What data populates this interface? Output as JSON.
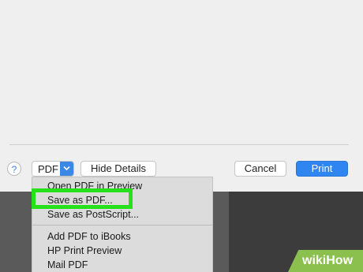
{
  "dialog": {
    "help_label": "?",
    "pdf_label": "PDF",
    "hide_details_label": "Hide Details",
    "cancel_label": "Cancel",
    "print_label": "Print"
  },
  "pdf_menu": {
    "items": [
      {
        "label": "Open PDF in Preview"
      },
      {
        "label": "Save as PDF..."
      },
      {
        "label": "Save as PostScript..."
      },
      {
        "label": "Add PDF to iBooks"
      },
      {
        "label": "HP Print Preview"
      },
      {
        "label": "Mail PDF"
      }
    ]
  },
  "watermark": {
    "text": "wikiHow"
  },
  "colors": {
    "accent": "#2f86f1",
    "highlight": "#27e11c",
    "watermark": "#8bbf4e"
  }
}
